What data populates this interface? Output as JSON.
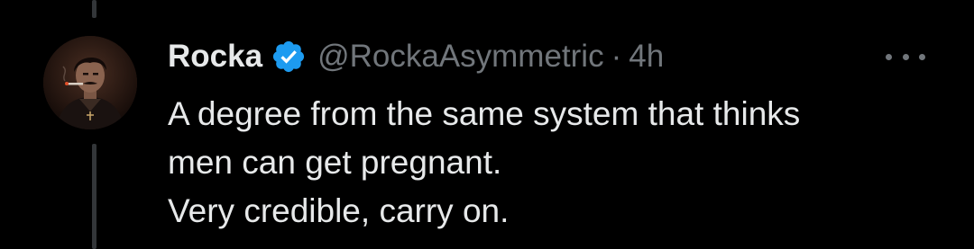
{
  "tweet": {
    "display_name": "Rocka",
    "handle": "@RockaAsymmetric",
    "separator": "·",
    "time": "4h",
    "lines": [
      "A degree from the same system that thinks",
      "men can get pregnant.",
      "Very credible, carry on."
    ],
    "verified_icon": "verified-badge-icon",
    "more_icon": "more-options-icon"
  },
  "colors": {
    "background": "#000000",
    "primary_text": "#e7e9ea",
    "secondary_text": "#71767b",
    "verified_blue": "#1d9bf0",
    "thread_line": "#333639"
  }
}
